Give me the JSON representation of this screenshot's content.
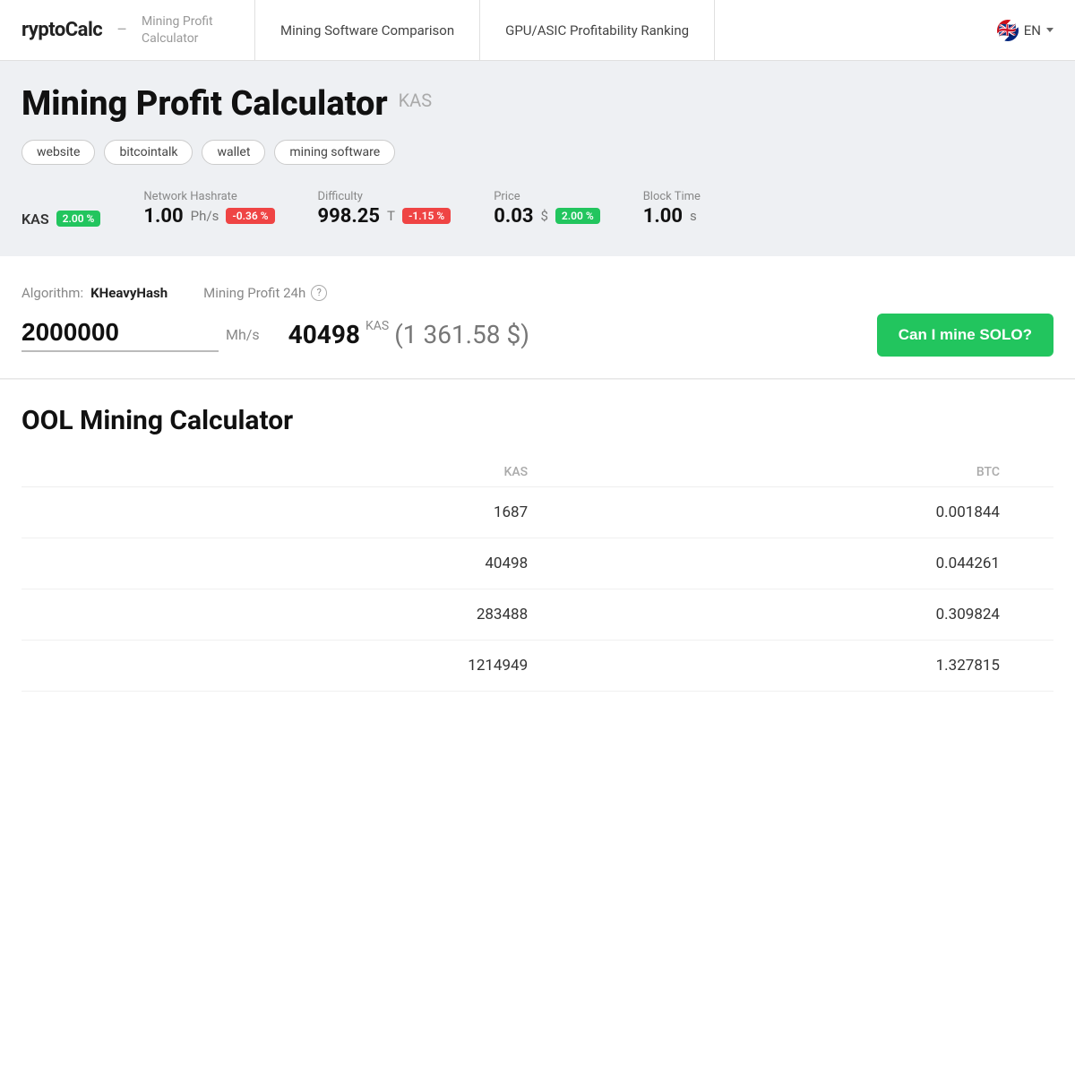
{
  "header": {
    "logo_name": "ryptoCalc",
    "logo_sep": "–",
    "logo_subtitle": "Mining Profit Calculator",
    "nav": [
      {
        "label": "Mining Software Comparison",
        "id": "nav-mining-software"
      },
      {
        "label": "GPU/ASIC Profitability Ranking",
        "id": "nav-gpu-asic"
      }
    ],
    "lang": "EN"
  },
  "kas_section": {
    "main_title": "Mining Profit Calculator",
    "ticker": "KAS",
    "links": [
      {
        "label": "website",
        "id": "link-website"
      },
      {
        "label": "bitcointalk",
        "id": "link-bitcointalk"
      },
      {
        "label": "wallet",
        "id": "link-wallet"
      },
      {
        "label": "mining software",
        "id": "link-mining-software"
      }
    ],
    "stats": {
      "coin_badge": "KAS",
      "coin_change": "2.00 %",
      "coin_change_type": "positive",
      "network_hashrate_label": "Network Hashrate",
      "network_hashrate_value": "1.00",
      "network_hashrate_unit": "Ph/s",
      "network_hashrate_change": "-0.36 %",
      "network_hashrate_change_type": "negative",
      "difficulty_label": "Difficulty",
      "difficulty_value": "998.25",
      "difficulty_unit": "T",
      "difficulty_change": "-1.15 %",
      "difficulty_change_type": "negative",
      "price_label": "Price",
      "price_value": "0.03",
      "price_unit": "$",
      "price_change": "2.00 %",
      "price_change_type": "positive",
      "block_time_label": "Block Time",
      "block_time_value": "1.00",
      "block_time_unit": "s"
    }
  },
  "calculator": {
    "algo_label": "Algorithm:",
    "algo_value": "KHeavyHash",
    "profit_label": "Mining Profit 24h",
    "hashrate_value": "2000000",
    "hashrate_unit": "Mh/s",
    "profit_kas": "40498",
    "profit_kas_ticker": "KAS",
    "profit_usd": "(1 361.58 $)",
    "solo_btn": "Can I mine SOLO?"
  },
  "pool_section": {
    "title": "OOL Mining Calculator",
    "col_headers": [
      "",
      "KAS",
      "BTC"
    ],
    "rows": [
      {
        "label": "",
        "kas": "1687",
        "btc": "0.001844"
      },
      {
        "label": "",
        "kas": "40498",
        "btc": "0.044261"
      },
      {
        "label": "",
        "kas": "283488",
        "btc": "0.309824"
      },
      {
        "label": "",
        "kas": "1214949",
        "btc": "1.327815"
      }
    ]
  }
}
